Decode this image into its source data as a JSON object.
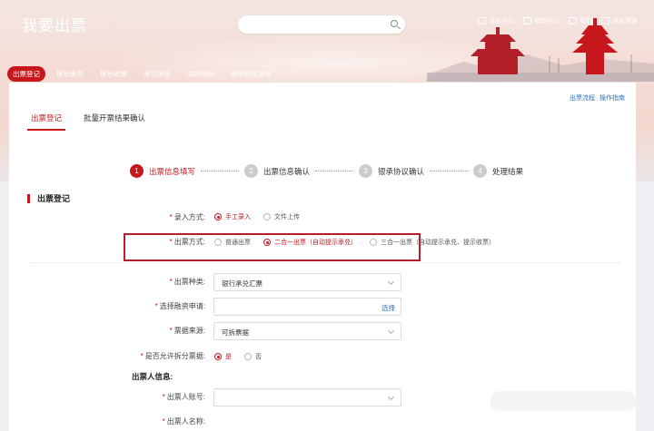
{
  "header": {
    "logo": "我要出票",
    "top_links": [
      "消息中心",
      "帮助中心",
      "我的",
      "退出登录"
    ]
  },
  "nav": {
    "items": [
      "出票登记",
      "提示承兑",
      "提示收票",
      "承兑保证",
      "未用退回",
      "撤承协议查询"
    ],
    "active_index": 0
  },
  "help_links": [
    "出票流程",
    "操作指南"
  ],
  "tabs": [
    "出票登记",
    "批量开票结果确认"
  ],
  "steps": [
    {
      "num": "1",
      "label": "出票信息填写"
    },
    {
      "num": "2",
      "label": "出票信息确认"
    },
    {
      "num": "3",
      "label": "银承协议确认"
    },
    {
      "num": "4",
      "label": "处理结果"
    }
  ],
  "section_title": "出票登记",
  "form": {
    "entry_mode": {
      "label": "录入方式:",
      "options": [
        "手工录入",
        "文件上传"
      ],
      "selected": 0
    },
    "issue_mode": {
      "label": "出票方式:",
      "options": [
        "普通出票",
        "二合一出票（自动提示承兑）",
        "三合一出票（自动提示承兑、提示收票）"
      ],
      "selected": 1
    },
    "bill_type": {
      "label": "出票种类:",
      "value": "银行承兑汇票"
    },
    "financing": {
      "label": "选择融资申请:",
      "value": "",
      "pick": "选择"
    },
    "bill_source": {
      "label": "票据来源:",
      "value": "可拆票据"
    },
    "allow_split": {
      "label": "是否允许拆分票据:",
      "options": [
        "是",
        "否"
      ],
      "selected": 0
    },
    "drawer_heading": "出票人信息:",
    "drawer_account": {
      "label": "出票人账号:",
      "value": ""
    },
    "drawer_name": {
      "label": "出票人名称:",
      "value": ""
    }
  },
  "colors": {
    "accent": "#c8161d",
    "link": "#2f6fb5"
  }
}
